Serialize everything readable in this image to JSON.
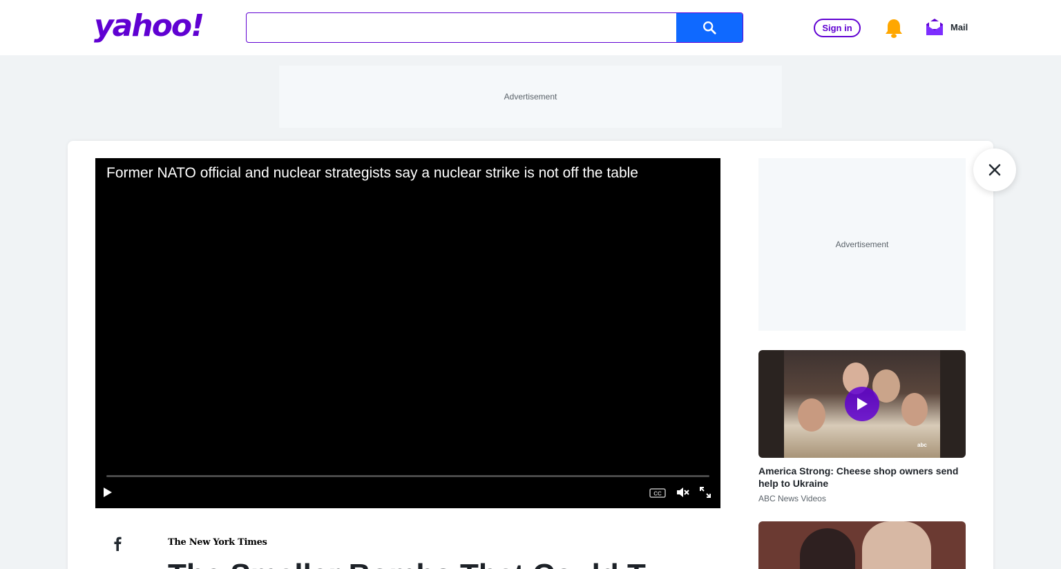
{
  "header": {
    "logo_text": "yahoo!",
    "search_placeholder": "",
    "signin_label": "Sign in",
    "mail_label": "Mail"
  },
  "ads": {
    "top_label": "Advertisement",
    "side_label": "Advertisement"
  },
  "player": {
    "title": "Former NATO official and nuclear strategists say a nuclear strike is not off the table",
    "progress": 0
  },
  "article": {
    "source": "The New York Times",
    "title_partial": "The Smaller Bombs That Could T"
  },
  "sidebar": {
    "videos": [
      {
        "title": "America Strong: Cheese shop owners send help to Ukraine",
        "source": "ABC News Videos",
        "badge": "abc"
      }
    ]
  },
  "colors": {
    "brand": "#6001d2",
    "search_button": "#0f69ff",
    "bell": "#ffa700",
    "page_bg": "#f0f3f5"
  }
}
